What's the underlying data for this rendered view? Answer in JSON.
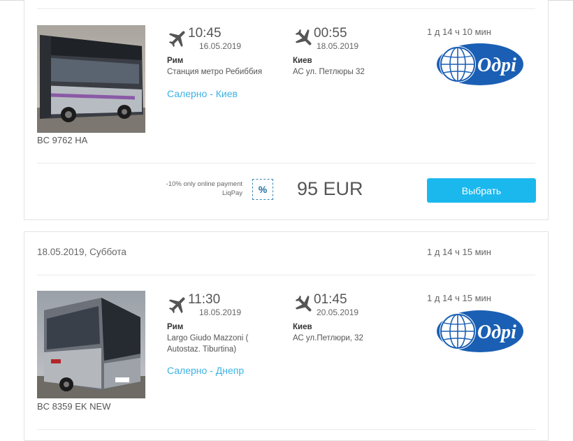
{
  "colors": {
    "accent": "#1bb8ee",
    "link": "#3bb2e6",
    "logo_blue": "#1a5fb4"
  },
  "trips": [
    {
      "plate": "BC 9762 HA",
      "depart": {
        "time": "10:45",
        "date": "16.05.2019",
        "city": "Рим",
        "stop": "Станция метро Ребиббия",
        "icon": "departure-plane-icon"
      },
      "arrive": {
        "time": "00:55",
        "date": "18.05.2019",
        "city": "Киев",
        "stop": "АС ул. Петлюры 32",
        "icon": "arrival-plane-icon"
      },
      "route": "Салерно - Киев",
      "duration": "1 д 14 ч 10 мин",
      "carrier_logo": "Одрі",
      "promo": "-10% only online payment LiqPay",
      "promo_badge": "%",
      "price": "95 EUR",
      "select_label": "Выбрать"
    },
    {
      "date_header": "18.05.2019, Суббота",
      "header_duration": "1 д 14 ч 15 мин",
      "plate": "BC 8359 EK NEW",
      "depart": {
        "time": "11:30",
        "date": "18.05.2019",
        "city": "Рим",
        "stop": "Largo Giudo Mazzoni ( Autostaz. Tiburtina)",
        "icon": "departure-plane-icon"
      },
      "arrive": {
        "time": "01:45",
        "date": "20.05.2019",
        "city": "Киев",
        "stop": "АС ул.Петлюри, 32",
        "icon": "arrival-plane-icon"
      },
      "route": "Салерно - Днепр",
      "duration": "1 д 14 ч 15 мин",
      "carrier_logo": "Одрі"
    }
  ]
}
